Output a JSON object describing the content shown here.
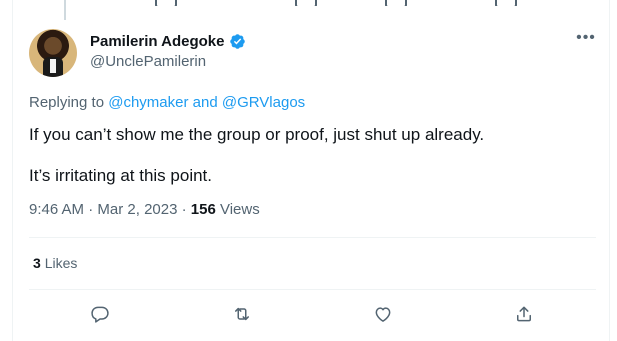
{
  "author": {
    "display_name": "Pamilerin Adegoke",
    "handle": "@UnclePamilerin",
    "verified": true
  },
  "replying": {
    "prefix": "Replying to ",
    "first": "@chymaker",
    "joiner": " and ",
    "second": "@GRVlagos"
  },
  "tweet": {
    "paragraphs": [
      "If you can’t show me the group or proof, just shut up already.",
      "It’s irritating at this point."
    ]
  },
  "meta": {
    "time": "9:46 AM",
    "date": "Mar 2, 2023",
    "views_count": "156",
    "views_label": "Views"
  },
  "stats": {
    "likes_count": "3",
    "likes_label": "Likes"
  },
  "icons": [
    "verified-badge-icon",
    "more-icon",
    "reply-icon",
    "retweet-icon",
    "like-icon",
    "share-icon"
  ],
  "colors": {
    "accent": "#1d9bf0",
    "secondary_text": "#536471",
    "primary_text": "#0f1419",
    "divider": "#eff3f4"
  }
}
